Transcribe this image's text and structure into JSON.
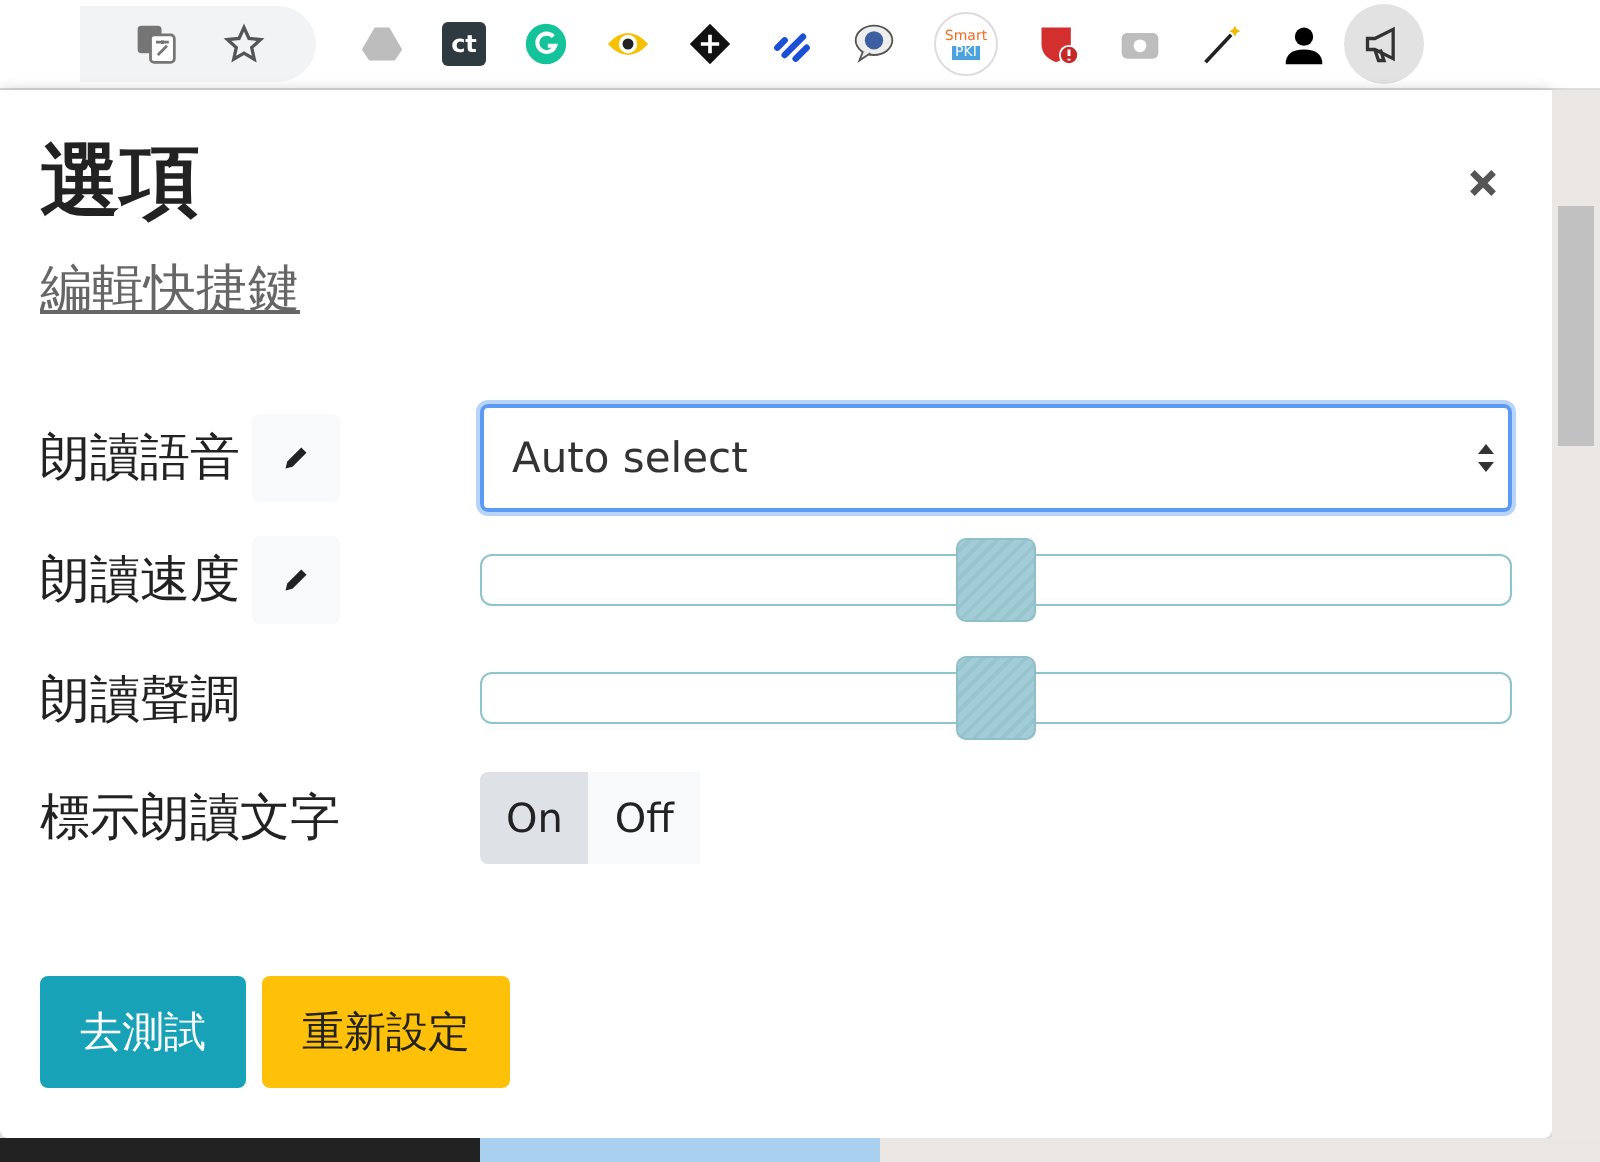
{
  "toolbar": {
    "extensions": [
      {
        "kind": "translate"
      },
      {
        "kind": "star"
      },
      {
        "kind": "drive"
      },
      {
        "kind": "ct",
        "label": "ct"
      },
      {
        "kind": "grammarly"
      },
      {
        "kind": "eye"
      },
      {
        "kind": "diamond"
      },
      {
        "kind": "stripes"
      },
      {
        "kind": "bubble"
      },
      {
        "kind": "pki",
        "label": "Smart",
        "sublabel": "PKI"
      },
      {
        "kind": "shield"
      },
      {
        "kind": "camera"
      },
      {
        "kind": "wand"
      },
      {
        "kind": "person"
      },
      {
        "kind": "megaphone",
        "selected": true
      }
    ]
  },
  "dialog": {
    "title": "選項",
    "shortcut_link": "編輯快捷鍵",
    "settings": [
      {
        "kind": "select",
        "label": "朗讀語音",
        "editable": true,
        "value": "Auto select",
        "focused": true
      },
      {
        "kind": "slider",
        "label": "朗讀速度",
        "editable": true,
        "level": 0.5
      },
      {
        "kind": "slider",
        "label": "朗讀聲調",
        "editable": false,
        "level": 0.5
      },
      {
        "kind": "toggle",
        "label": "標示朗讀文字",
        "editable": false,
        "options": [
          {
            "label": "On",
            "selected": true
          },
          {
            "label": "Off",
            "selected": false
          }
        ]
      }
    ],
    "buttons": [
      {
        "label": "去測試",
        "kind": "primary"
      },
      {
        "label": "重新設定",
        "kind": "warning"
      }
    ]
  }
}
